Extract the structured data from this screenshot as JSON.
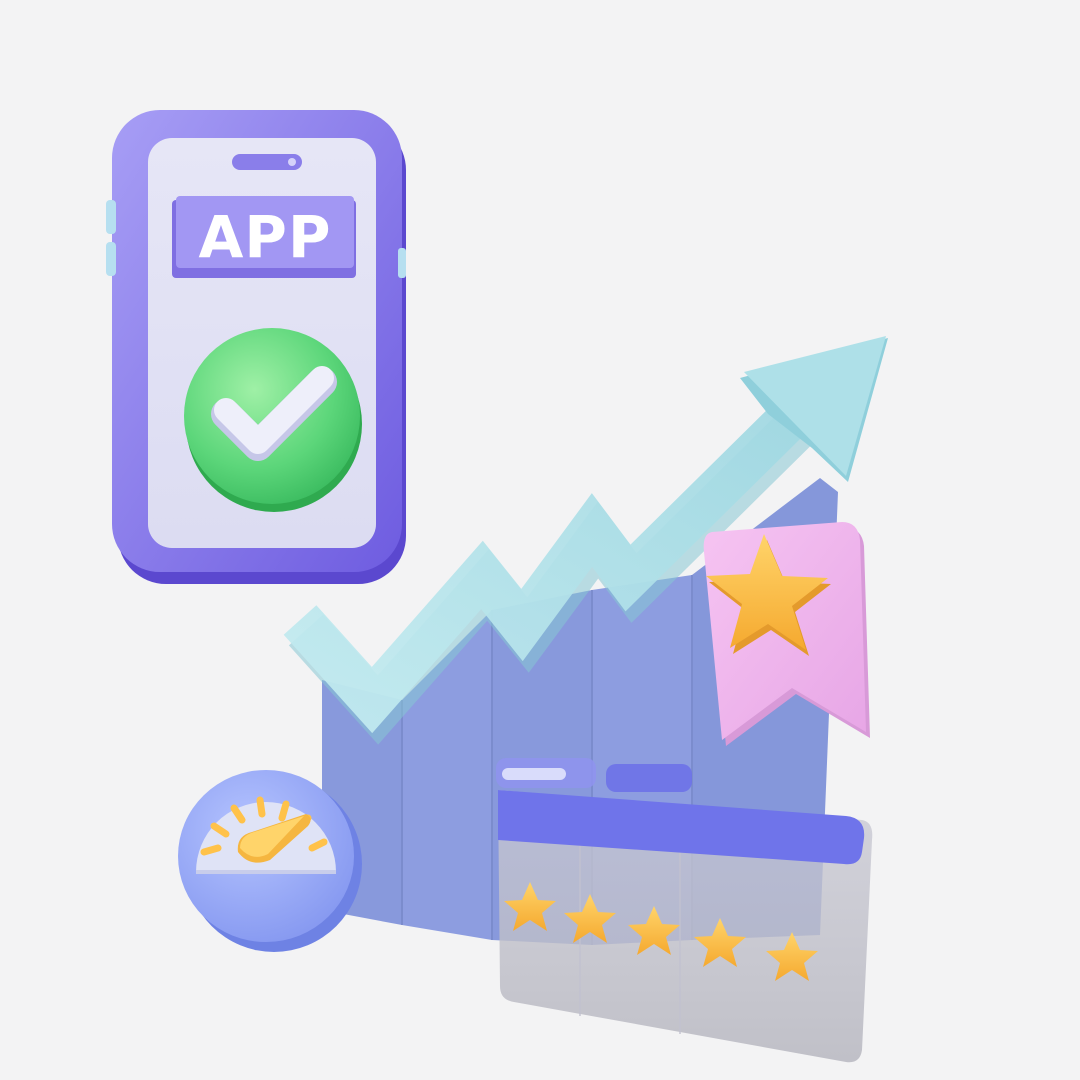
{
  "phone": {
    "label": "APP",
    "check_icon": "check-icon"
  },
  "growth": {
    "arrow_icon": "trend-up-arrow-icon",
    "bar_count": 5
  },
  "bookmark": {
    "icon": "star-bookmark-icon"
  },
  "gauge": {
    "icon": "speedometer-icon"
  },
  "rating": {
    "stars": 5,
    "max": 5
  },
  "colors": {
    "background": "#f3f3f4",
    "phone": "#8b7fe8",
    "check_green": "#5cd67a",
    "arrow": "#a9dde6",
    "bars": "#8d9de0",
    "bookmark": "#f2b2ec",
    "star": "#ffc24a",
    "browser_bar": "#6f74ea"
  }
}
